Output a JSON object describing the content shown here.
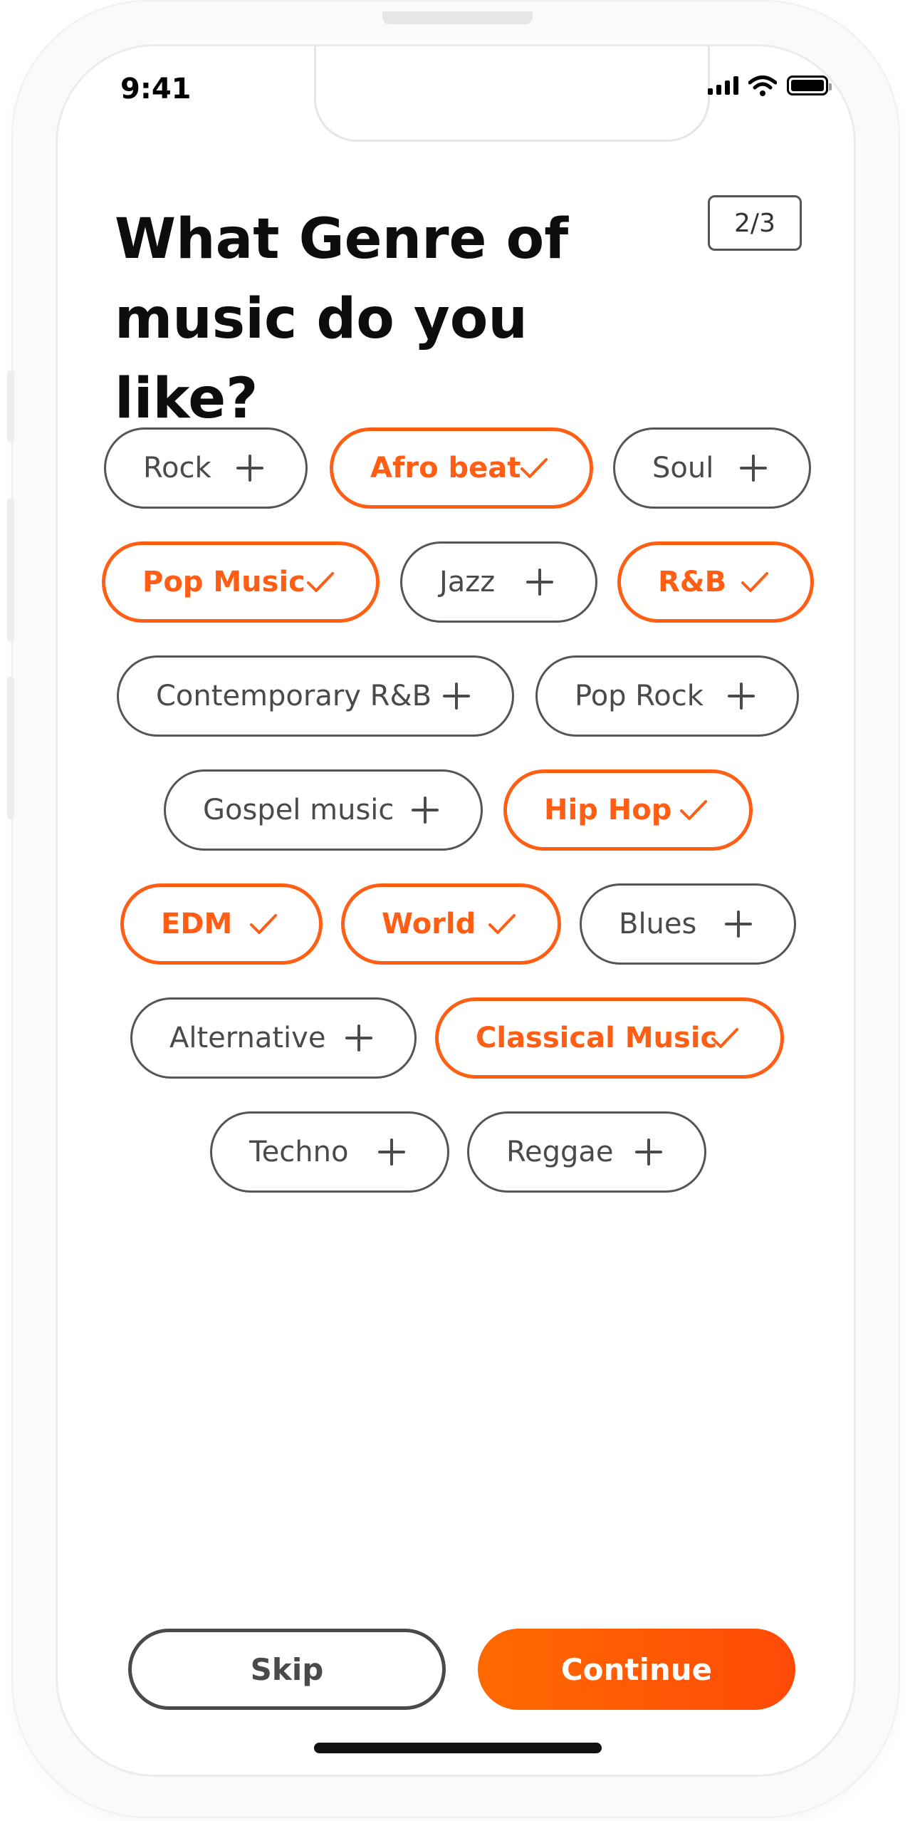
{
  "status_bar": {
    "time": "9:41"
  },
  "header": {
    "title_line1": "What Genre of",
    "title_line2": "music do you like?",
    "step": "2/3"
  },
  "colors": {
    "accent": "#ff5e14",
    "chip_border": "#555555",
    "text": "#0d0d0d"
  },
  "genres": [
    {
      "label": "Rock",
      "selected": false,
      "icon": "plus-icon"
    },
    {
      "label": "Afro beat",
      "selected": true,
      "icon": "check-icon"
    },
    {
      "label": "Soul",
      "selected": false,
      "icon": "plus-icon"
    },
    {
      "label": "Pop Music",
      "selected": true,
      "icon": "check-icon"
    },
    {
      "label": "Jazz",
      "selected": false,
      "icon": "plus-icon"
    },
    {
      "label": "R&B",
      "selected": true,
      "icon": "check-icon"
    },
    {
      "label": "Contemporary R&B",
      "selected": false,
      "icon": "plus-icon"
    },
    {
      "label": "Pop Rock",
      "selected": false,
      "icon": "plus-icon"
    },
    {
      "label": "Gospel music",
      "selected": false,
      "icon": "plus-icon"
    },
    {
      "label": "Hip Hop",
      "selected": true,
      "icon": "check-icon"
    },
    {
      "label": "EDM",
      "selected": true,
      "icon": "check-icon"
    },
    {
      "label": "World",
      "selected": true,
      "icon": "check-icon"
    },
    {
      "label": "Blues",
      "selected": false,
      "icon": "plus-icon"
    },
    {
      "label": "Alternative",
      "selected": false,
      "icon": "plus-icon"
    },
    {
      "label": "Classical Music",
      "selected": true,
      "icon": "check-icon"
    },
    {
      "label": "Techno",
      "selected": false,
      "icon": "plus-icon"
    },
    {
      "label": "Reggae",
      "selected": false,
      "icon": "plus-icon"
    }
  ],
  "footer": {
    "skip_label": "Skip",
    "continue_label": "Continue"
  }
}
